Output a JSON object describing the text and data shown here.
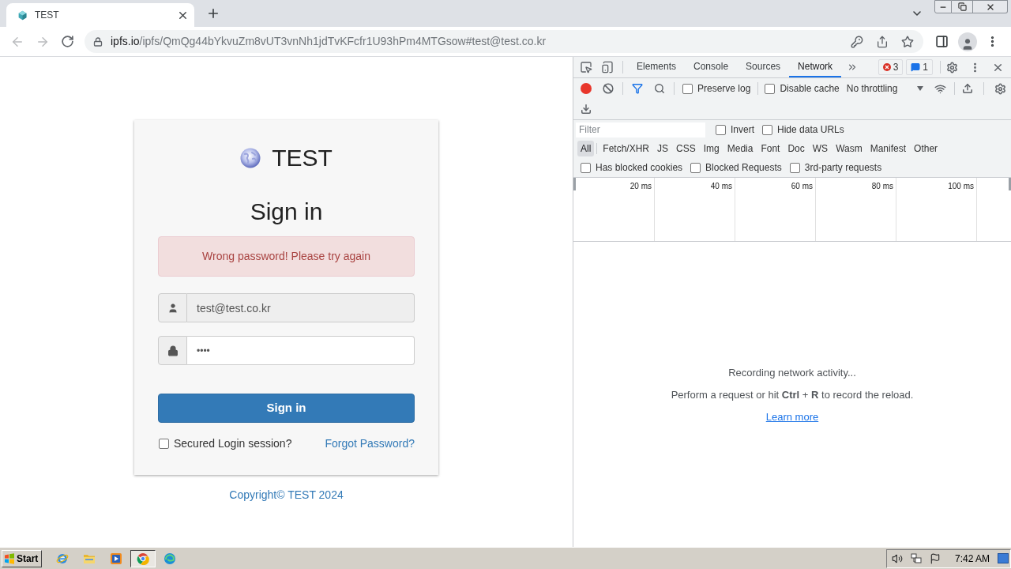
{
  "browser": {
    "tabs": [
      {
        "title": "TEST",
        "selected": true
      }
    ],
    "address": {
      "host": "ipfs.io",
      "path": "/ipfs/QmQg44bYkvuZm8vUT3vnNh1jdTvKFcfr1U93hPm4MTGsow#test@test.co.kr"
    }
  },
  "login": {
    "brand": "TEST",
    "heading": "Sign in",
    "alert": "Wrong password! Please try again",
    "email": {
      "value": "test@test.co.kr",
      "disabled": true
    },
    "password": {
      "value": "••••",
      "disabled": false
    },
    "submit": "Sign in",
    "remember": {
      "label": "Secured Login session?",
      "checked": false
    },
    "forgot": "Forgot Password?",
    "copyright": "Copyright© TEST 2024"
  },
  "devtools": {
    "tabs": [
      {
        "label": "Elements",
        "selected": false
      },
      {
        "label": "Console",
        "selected": false
      },
      {
        "label": "Sources",
        "selected": false
      },
      {
        "label": "Network",
        "selected": true
      }
    ],
    "error_count": "3",
    "message_count": "1",
    "recording": true,
    "toolbar_options": [
      {
        "label": "Preserve log",
        "checked": false
      },
      {
        "label": "Disable cache",
        "checked": false
      }
    ],
    "throttling": "No throttling",
    "filter": {
      "placeholder": "Filter"
    },
    "filter_options": [
      {
        "label": "Invert",
        "checked": false
      },
      {
        "label": "Hide data URLs",
        "checked": false
      }
    ],
    "resource_types": [
      {
        "label": "All",
        "selected": true
      },
      {
        "label": "Fetch/XHR",
        "selected": false
      },
      {
        "label": "JS",
        "selected": false
      },
      {
        "label": "CSS",
        "selected": false
      },
      {
        "label": "Img",
        "selected": false
      },
      {
        "label": "Media",
        "selected": false
      },
      {
        "label": "Font",
        "selected": false
      },
      {
        "label": "Doc",
        "selected": false
      },
      {
        "label": "WS",
        "selected": false
      },
      {
        "label": "Wasm",
        "selected": false
      },
      {
        "label": "Manifest",
        "selected": false
      },
      {
        "label": "Other",
        "selected": false
      }
    ],
    "request_options": [
      {
        "label": "Has blocked cookies",
        "checked": false
      },
      {
        "label": "Blocked Requests",
        "checked": false
      },
      {
        "label": "3rd-party requests",
        "checked": false
      }
    ],
    "timeline_ticks": [
      "20 ms",
      "40 ms",
      "60 ms",
      "80 ms",
      "100 ms"
    ],
    "empty_state": {
      "title": "Recording network activity...",
      "hint": "Perform a request or hit **Ctrl** + **R** to record the reload.",
      "link": "Learn more"
    }
  },
  "taskbar": {
    "start": "Start",
    "apps": [
      {
        "selected": false
      },
      {
        "selected": false
      },
      {
        "selected": false
      },
      {
        "selected": true
      },
      {
        "selected": false
      }
    ],
    "clock": "7:42 AM"
  }
}
